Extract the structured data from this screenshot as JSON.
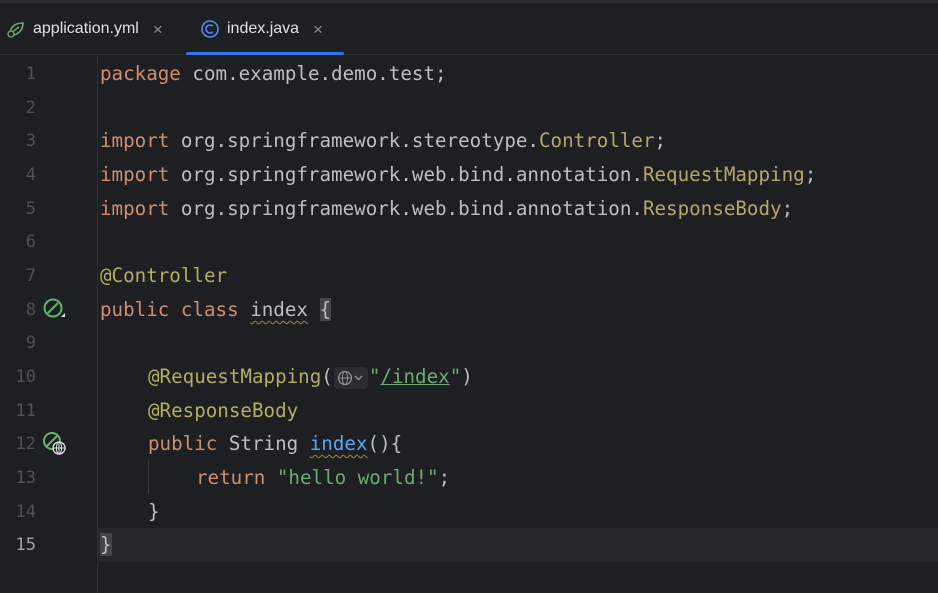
{
  "tabs": [
    {
      "label": "application.yml",
      "icon": "spring-leaf-icon",
      "close": "×",
      "active": false
    },
    {
      "label": "index.java",
      "icon": "class-c-icon",
      "close": "×",
      "active": true
    }
  ],
  "editor": {
    "current_line": 15,
    "line_numbers": [
      "1",
      "2",
      "3",
      "4",
      "5",
      "6",
      "7",
      "8",
      "9",
      "10",
      "11",
      "12",
      "13",
      "14",
      "15"
    ],
    "lines": {
      "l1": {
        "kw": "package",
        "rest": " com.example.demo.test;"
      },
      "l3": {
        "kw": "import",
        "pkg": " org.springframework.stereotype.",
        "cls": "Controller",
        "end": ";"
      },
      "l4": {
        "kw": "import",
        "pkg": " org.springframework.web.bind.annotation.",
        "cls": "RequestMapping",
        "end": ";"
      },
      "l5": {
        "kw": "import",
        "pkg": " org.springframework.web.bind.annotation.",
        "cls": "ResponseBody",
        "end": ";"
      },
      "l7": {
        "ann": "@Controller"
      },
      "l8": {
        "kw1": "public",
        "kw2": "class",
        "name": "index",
        "brace": "{"
      },
      "l10": {
        "ann": "@RequestMapping",
        "open": "(",
        "q1": "\"",
        "path": "/index",
        "q2": "\"",
        "close": ")"
      },
      "l11": {
        "ann": "@ResponseBody"
      },
      "l12": {
        "kw": "public",
        "type": "String",
        "method": "index",
        "rest": "(){"
      },
      "l13": {
        "kw": "return",
        "str": "\"hello world!\"",
        "end": ";"
      },
      "l14": {
        "brace": "}"
      },
      "l15": {
        "brace": "}"
      }
    },
    "gutter_icons": [
      {
        "line": 8,
        "icon": "spring-bean-icon"
      },
      {
        "line": 12,
        "icon": "spring-web-endpoint-icon"
      }
    ],
    "inlay_hint_icon": "globe-dropdown-icon"
  },
  "colors": {
    "background": "#1e1f22",
    "keyword": "#cf8e6d",
    "annotation": "#b3ae60",
    "string": "#6aab73",
    "method": "#56a8f5",
    "tab_accent": "#3574f0"
  }
}
